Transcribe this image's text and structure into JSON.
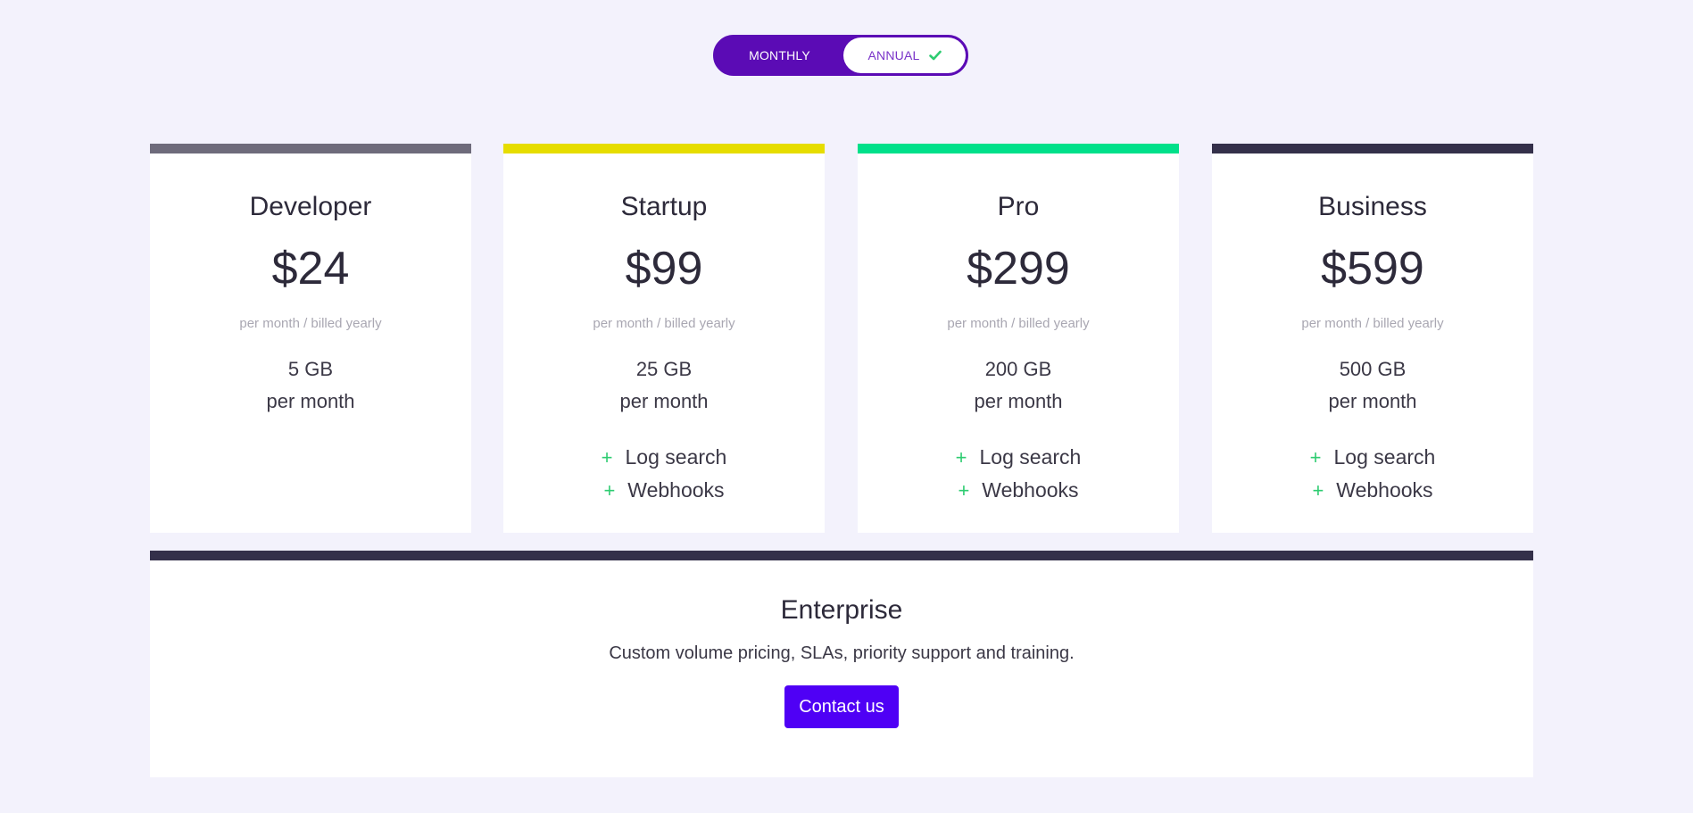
{
  "billing_toggle": {
    "monthly_label": "MONTHLY",
    "annual_label": "ANNUAL",
    "selected": "ANNUAL",
    "check_icon": "check-icon",
    "accent_color": "#5b0bb5",
    "check_color": "#2ecc71"
  },
  "plans": [
    {
      "name": "Developer",
      "price": "$24",
      "billing": "per month / billed yearly",
      "storage": "5 GB",
      "storage_period": "per month",
      "features": [],
      "bar_color": "#6e6b7b"
    },
    {
      "name": "Startup",
      "price": "$99",
      "billing": "per month / billed yearly",
      "storage": "25 GB",
      "storage_period": "per month",
      "features": [
        "Log search",
        "Webhooks"
      ],
      "bar_color": "#e6dd00"
    },
    {
      "name": "Pro",
      "price": "$299",
      "billing": "per month / billed yearly",
      "storage": "200 GB",
      "storage_period": "per month",
      "features": [
        "Log search",
        "Webhooks"
      ],
      "bar_color": "#00e08a"
    },
    {
      "name": "Business",
      "price": "$599",
      "billing": "per month / billed yearly",
      "storage": "500 GB",
      "storage_period": "per month",
      "features": [
        "Log search",
        "Webhooks"
      ],
      "bar_color": "#34304a"
    }
  ],
  "feature_icon": "+",
  "enterprise": {
    "name": "Enterprise",
    "description": "Custom volume pricing, SLAs, priority support and training.",
    "button_label": "Contact us",
    "bar_color": "#34304a",
    "button_color": "#4f00f5"
  }
}
